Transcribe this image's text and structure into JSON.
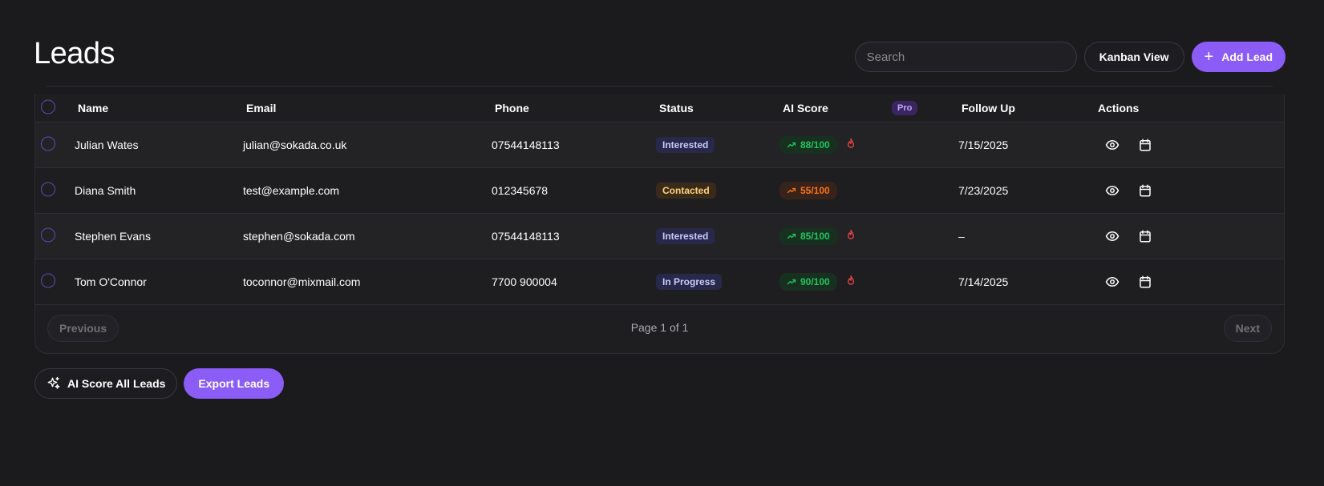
{
  "page": {
    "title": "Leads"
  },
  "toolbar": {
    "search_placeholder": "Search",
    "kanban_label": "Kanban View",
    "add_lead_label": "Add Lead"
  },
  "table": {
    "headers": {
      "name": "Name",
      "email": "Email",
      "phone": "Phone",
      "status": "Status",
      "ai_score": "AI Score",
      "pro_badge": "Pro",
      "follow_up": "Follow Up",
      "actions": "Actions"
    },
    "rows": [
      {
        "name": "Julian Wates",
        "email": "julian@sokada.co.uk",
        "phone": "07544148113",
        "status": "Interested",
        "status_kind": "interested",
        "score": "88/100",
        "score_color": "#22c55e",
        "hot": true,
        "follow_up": "7/15/2025"
      },
      {
        "name": "Diana Smith",
        "email": "test@example.com",
        "phone": "012345678",
        "status": "Contacted",
        "status_kind": "contacted",
        "score": "55/100",
        "score_color": "#f97316",
        "hot": false,
        "follow_up": "7/23/2025"
      },
      {
        "name": "Stephen Evans",
        "email": "stephen@sokada.com",
        "phone": "07544148113",
        "status": "Interested",
        "status_kind": "interested",
        "score": "85/100",
        "score_color": "#22c55e",
        "hot": true,
        "follow_up": "–"
      },
      {
        "name": "Tom O'Connor",
        "email": "toconnor@mixmail.com",
        "phone": "7700 900004",
        "status": "In Progress",
        "status_kind": "progress",
        "score": "90/100",
        "score_color": "#22c55e",
        "hot": true,
        "follow_up": "7/14/2025"
      }
    ],
    "row_actions": {
      "view_icon": "eye-icon",
      "schedule_icon": "calendar-icon"
    }
  },
  "pagination": {
    "previous_label": "Previous",
    "page_text": "Page 1 of 1",
    "next_label": "Next"
  },
  "footer_actions": {
    "ai_score_label": "AI Score All Leads",
    "export_label": "Export Leads"
  },
  "colors": {
    "accent": "#8b5cf6",
    "background": "#1b1b1e",
    "hot_icon": "#ef4444"
  }
}
